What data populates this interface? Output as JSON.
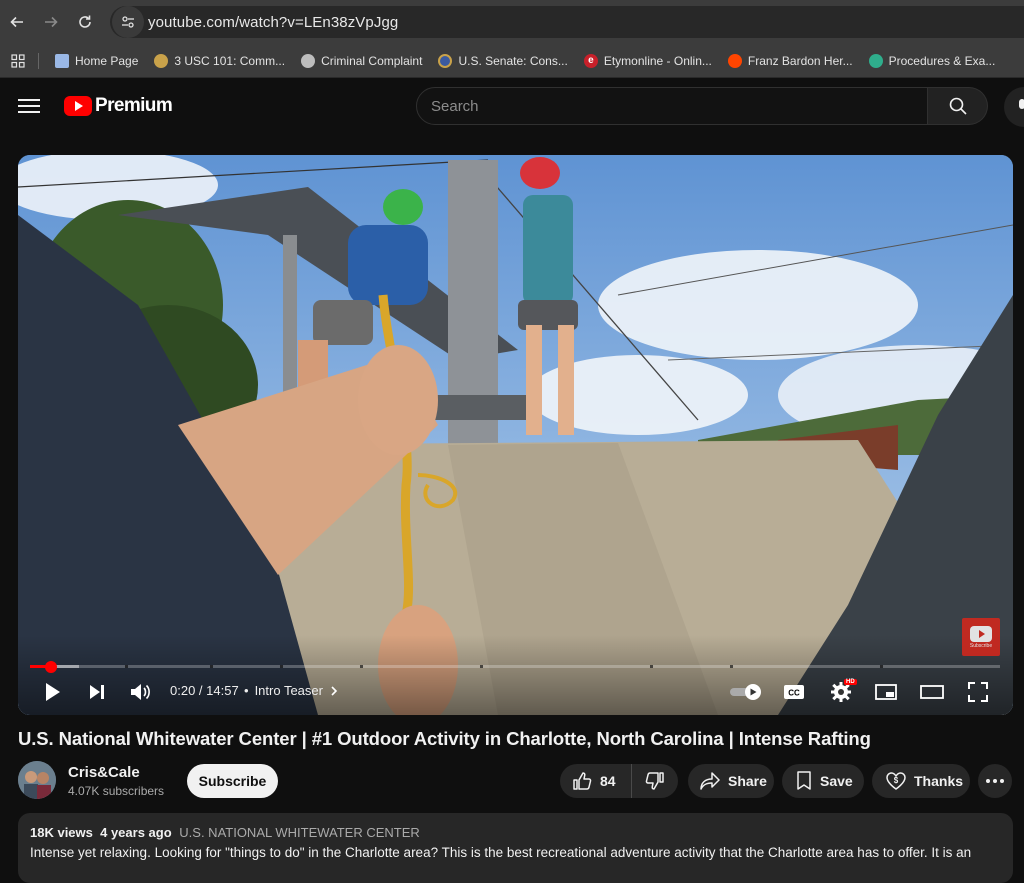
{
  "browser": {
    "url": "youtube.com/watch?v=LEn38zVpJgg",
    "bookmarks": [
      {
        "label": "Home Page",
        "icon": "page-icon",
        "color": "#9ab8e6"
      },
      {
        "label": "3 USC 101: Comm...",
        "icon": "seal-icon",
        "color": "#c9a24a"
      },
      {
        "label": "Criminal Complaint",
        "icon": "globe-icon",
        "color": "#bdbdbd"
      },
      {
        "label": "U.S. Senate: Cons...",
        "icon": "seal-icon",
        "color": "#3b5aa0"
      },
      {
        "label": "Etymonline - Onlin...",
        "icon": "e-icon",
        "color": "#c8202a"
      },
      {
        "label": "Franz Bardon Her...",
        "icon": "reddit-icon",
        "color": "#ff4500"
      },
      {
        "label": "Procedures & Exa...",
        "icon": "gem-icon",
        "color": "#2fae8c"
      }
    ]
  },
  "header": {
    "logo_text": "Premium",
    "search_placeholder": "Search"
  },
  "player": {
    "time": "0:20 / 14:57",
    "chapter": "Intro Teaser",
    "progress_played": 0.022,
    "progress_buffered": 0.05,
    "watermark_label": "Subscribe",
    "hd_badge": "HD"
  },
  "video": {
    "title": "U.S. National Whitewater Center | #1 Outdoor Activity in Charlotte, North Carolina | Intense Rafting",
    "channel": "Cris&Cale",
    "subscribers": "4.07K subscribers",
    "subscribe_label": "Subscribe",
    "likes": "84",
    "share_label": "Share",
    "save_label": "Save",
    "thanks_label": "Thanks"
  },
  "description": {
    "views": "18K views",
    "age": "4 years ago",
    "tag": "U.S. NATIONAL WHITEWATER CENTER",
    "text": "Intense yet relaxing.  Looking for \"things to do\" in the Charlotte area?  This is the best recreational adventure activity that the Charlotte area has to offer.  It is an"
  }
}
